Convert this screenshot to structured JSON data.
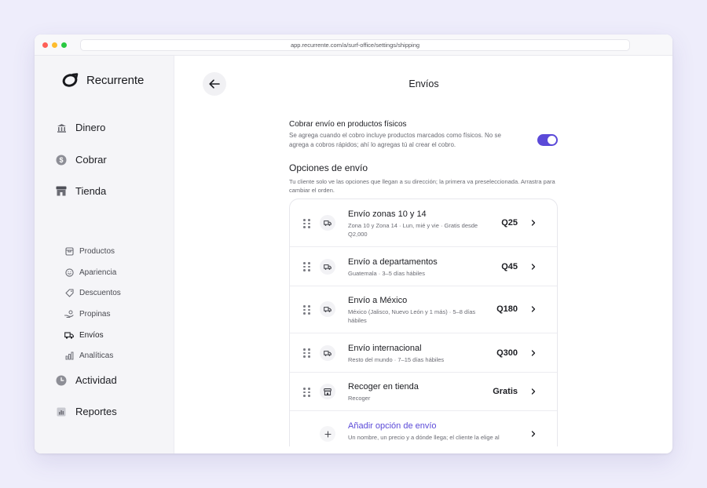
{
  "browser": {
    "url": "app.recurrente.com/a/surf-office/settings/shipping"
  },
  "sidebar": {
    "brand": "Recurrente",
    "items": [
      {
        "label": "Dinero",
        "icon": "bank-icon"
      },
      {
        "label": "Cobrar",
        "icon": "dollar-icon"
      },
      {
        "label": "Tienda",
        "icon": "store-icon"
      },
      {
        "label": "Actividad",
        "icon": "clock-icon"
      },
      {
        "label": "Reportes",
        "icon": "chart-icon"
      }
    ],
    "subitems": [
      {
        "label": "Productos",
        "icon": "box-icon"
      },
      {
        "label": "Apariencia",
        "icon": "smile-icon"
      },
      {
        "label": "Descuentos",
        "icon": "tag-icon"
      },
      {
        "label": "Propinas",
        "icon": "hand-coin-icon"
      },
      {
        "label": "Envíos",
        "icon": "truck-icon",
        "active": true
      },
      {
        "label": "Analíticas",
        "icon": "bars-icon"
      }
    ]
  },
  "header": {
    "title": "Envíos"
  },
  "shipping_toggle": {
    "title": "Cobrar envío en productos físicos",
    "description": "Se agrega cuando el cobro incluye productos marcados como físicos. No se agrega a cobros rápidos; ahí lo agregas tú al crear el cobro.",
    "enabled": true
  },
  "options_section": {
    "title": "Opciones de envío",
    "description": "Tu cliente solo ve las opciones que llegan a su dirección; la primera va preseleccionada. Arrastra para cambiar el orden.",
    "options": [
      {
        "name": "Envío zonas 10 y 14",
        "meta": "Zona 10 y Zona 14 · Lun, mié y vie · Gratis desde Q2,000",
        "price": "Q25",
        "icon": "truck-icon"
      },
      {
        "name": "Envío a departamentos",
        "meta": "Guatemala · 3–5 días hábiles",
        "price": "Q45",
        "icon": "truck-icon"
      },
      {
        "name": "Envío a México",
        "meta": "México (Jalisco, Nuevo León y 1 más) · 5–8 días hábiles",
        "price": "Q180",
        "icon": "truck-icon"
      },
      {
        "name": "Envío internacional",
        "meta": "Resto del mundo · 7–15 días hábiles",
        "price": "Q300",
        "icon": "truck-icon"
      },
      {
        "name": "Recoger en tienda",
        "meta": "Recoger",
        "price": "Gratis",
        "icon": "store-icon"
      }
    ],
    "add": {
      "name": "Añadir opción de envío",
      "meta": "Un nombre, un precio y a dónde llega; el cliente la elige al"
    }
  },
  "colors": {
    "accent": "#5b4ad8",
    "background": "#eeedfb"
  }
}
